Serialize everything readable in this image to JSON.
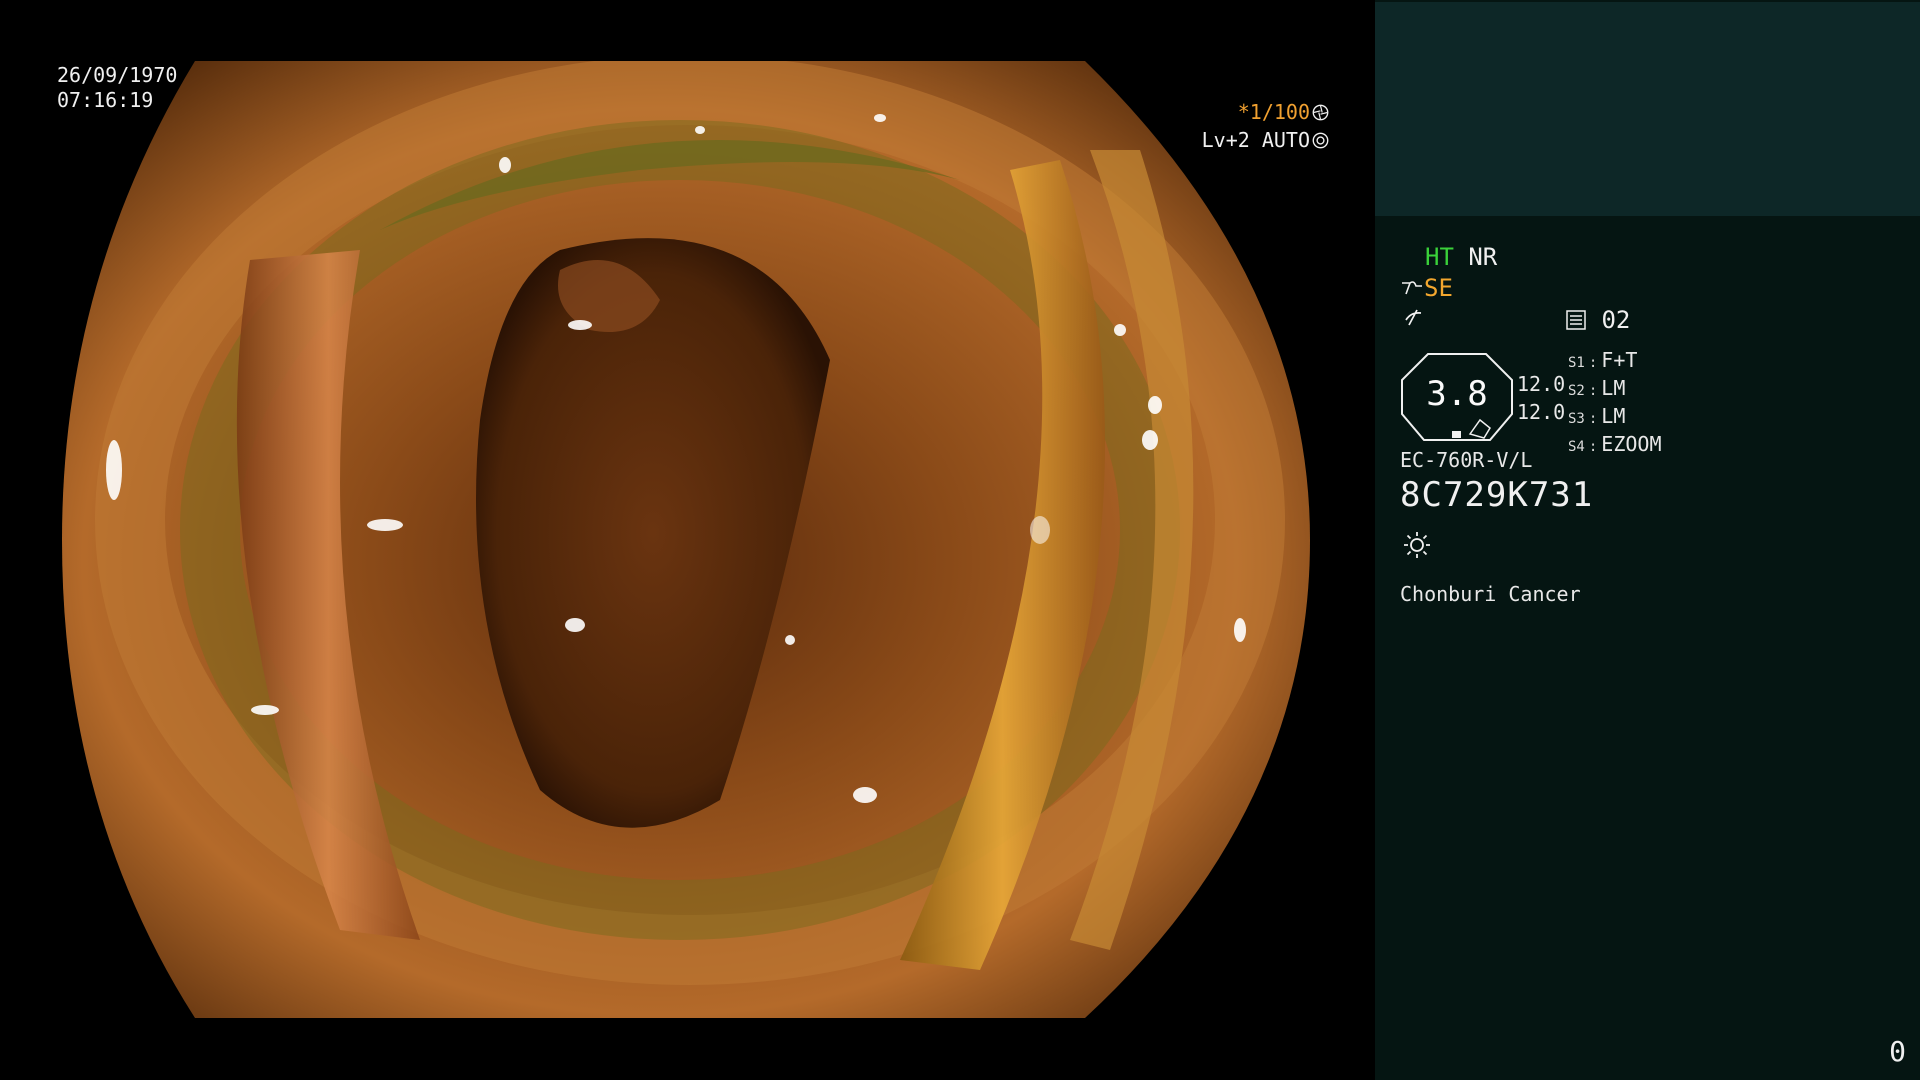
{
  "overlay": {
    "date": "26/09/1970",
    "time": "07:16:19",
    "shutter_speed": "*1/100",
    "brightness_mode": "Lv+2 AUTO"
  },
  "panel": {
    "ht_label": "HT",
    "nr_label": "NR",
    "se_label": "SE",
    "memory_label": "02",
    "zoom_value": "3.8",
    "val_top": "12.0",
    "val_bottom": "12.0",
    "switches": [
      {
        "key": "S1",
        "value": "F+T"
      },
      {
        "key": "S2",
        "value": "LM"
      },
      {
        "key": "S3",
        "value": "LM"
      },
      {
        "key": "S4",
        "value": "EZOOM"
      }
    ],
    "scope_model": "EC-760R-V/L",
    "serial": "8C729K731",
    "facility": "Chonburi Cancer",
    "page_number": "0"
  },
  "colors": {
    "panel_bg": "#051512",
    "panel_top_bg": "#0d2727",
    "ht_green": "#3ad13a",
    "se_orange": "#f3a72e"
  },
  "icons": [
    "aperture-icon",
    "auto-iris-icon",
    "scope-signal-icon",
    "enhance-icon",
    "memory-card-icon",
    "light-source-icon",
    "zoom-octagon-icon"
  ]
}
